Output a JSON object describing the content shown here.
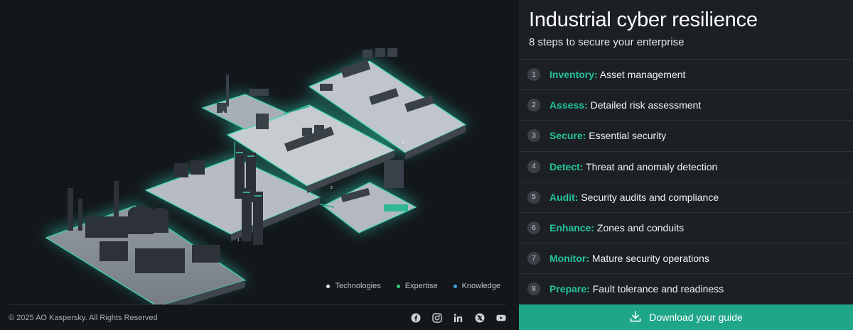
{
  "panel": {
    "title": "Industrial cyber resilience",
    "subtitle": "8 steps to secure your enterprise"
  },
  "steps": [
    {
      "num": "1",
      "key": "Inventory:",
      "text": " Asset management"
    },
    {
      "num": "2",
      "key": "Assess:",
      "text": " Detailed risk assessment"
    },
    {
      "num": "3",
      "key": "Secure:",
      "text": " Essential security"
    },
    {
      "num": "4",
      "key": "Detect:",
      "text": " Threat and anomaly detection"
    },
    {
      "num": "5",
      "key": "Audit:",
      "text": " Security audits and compliance"
    },
    {
      "num": "6",
      "key": "Enhance:",
      "text": " Zones and conduits"
    },
    {
      "num": "7",
      "key": "Monitor:",
      "text": " Mature security operations"
    },
    {
      "num": "8",
      "key": "Prepare:",
      "text": " Fault tolerance and readiness"
    }
  ],
  "cta": {
    "label": "Download your guide",
    "icon": "download-icon"
  },
  "legend": [
    {
      "label": "Technologies",
      "color": "#e9ecef"
    },
    {
      "label": "Expertise",
      "color": "#33d17a"
    },
    {
      "label": "Knowledge",
      "color": "#3aa2e0"
    }
  ],
  "footer": {
    "copyright": "© 2025 AO Kaspersky. All Rights Reserved"
  },
  "socials": [
    "facebook-icon",
    "instagram-icon",
    "linkedin-icon",
    "x-icon",
    "youtube-icon"
  ],
  "colors": {
    "accent": "#22c39b",
    "cta_bg": "#1fa688",
    "glow": "#39d6b0"
  }
}
